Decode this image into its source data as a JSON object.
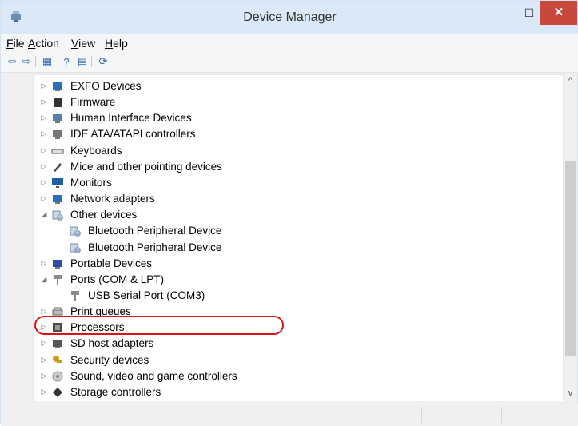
{
  "window": {
    "title": "Device Manager"
  },
  "menu": [
    {
      "label": "File",
      "underline": "F",
      "rest": "ile"
    },
    {
      "label": "Action",
      "underline": "A",
      "rest": "ction"
    },
    {
      "label": "View",
      "underline": "V",
      "rest": "iew"
    },
    {
      "label": "Help",
      "underline": "H",
      "rest": "elp"
    }
  ],
  "toolbar": [
    {
      "name": "back-icon",
      "glyph": "⇦"
    },
    {
      "name": "forward-icon",
      "glyph": "⇨"
    },
    {
      "name": "properties-icon",
      "glyph": "▦"
    },
    {
      "name": "help-icon",
      "glyph": "?"
    },
    {
      "name": "view-icon",
      "glyph": "▤"
    },
    {
      "name": "scan-hardware-icon",
      "glyph": "⟳"
    }
  ],
  "tree": [
    {
      "label": "EXFO Devices",
      "level": 0,
      "state": "collapsed",
      "icon": "network-device-icon",
      "color": "#2c6fb5"
    },
    {
      "label": "Firmware",
      "level": 0,
      "state": "collapsed",
      "icon": "firmware-chip-icon",
      "color": "#333333"
    },
    {
      "label": "Human Interface Devices",
      "level": 0,
      "state": "collapsed",
      "icon": "hid-icon",
      "color": "#5b7ea8"
    },
    {
      "label": "IDE ATA/ATAPI controllers",
      "level": 0,
      "state": "collapsed",
      "icon": "ide-controller-icon",
      "color": "#777777"
    },
    {
      "label": "Keyboards",
      "level": 0,
      "state": "collapsed",
      "icon": "keyboard-icon",
      "color": "#555555"
    },
    {
      "label": "Mice and other pointing devices",
      "level": 0,
      "state": "collapsed",
      "icon": "mouse-icon",
      "color": "#444444"
    },
    {
      "label": "Monitors",
      "level": 0,
      "state": "collapsed",
      "icon": "monitor-icon",
      "color": "#1f5fa8"
    },
    {
      "label": "Network adapters",
      "level": 0,
      "state": "collapsed",
      "icon": "network-adapter-icon",
      "color": "#2c6fb5"
    },
    {
      "label": "Other devices",
      "level": 0,
      "state": "expanded",
      "icon": "unknown-device-icon",
      "color": "#7a8fa8"
    },
    {
      "label": "Bluetooth Peripheral Device",
      "level": 1,
      "state": "leaf",
      "icon": "unknown-device-icon",
      "color": "#7a8fa8"
    },
    {
      "label": "Bluetooth Peripheral Device",
      "level": 1,
      "state": "leaf",
      "icon": "unknown-device-icon",
      "color": "#7a8fa8"
    },
    {
      "label": "Portable Devices",
      "level": 0,
      "state": "collapsed",
      "icon": "portable-device-icon",
      "color": "#2c4fa0"
    },
    {
      "label": "Ports (COM & LPT)",
      "level": 0,
      "state": "expanded",
      "icon": "port-icon",
      "color": "#8a8a8a"
    },
    {
      "label": "USB Serial Port (COM3)",
      "level": 1,
      "state": "leaf",
      "icon": "port-icon",
      "color": "#8a8a8a"
    },
    {
      "label": "Print queues",
      "level": 0,
      "state": "collapsed",
      "icon": "printer-icon",
      "color": "#666666"
    },
    {
      "label": "Processors",
      "level": 0,
      "state": "collapsed",
      "icon": "processor-icon",
      "color": "#4a4a4a"
    },
    {
      "label": "SD host adapters",
      "level": 0,
      "state": "collapsed",
      "icon": "sd-adapter-icon",
      "color": "#555555"
    },
    {
      "label": "Security devices",
      "level": 0,
      "state": "collapsed",
      "icon": "security-key-icon",
      "color": "#c99a1e"
    },
    {
      "label": "Sound, video and game controllers",
      "level": 0,
      "state": "collapsed",
      "icon": "sound-icon",
      "color": "#888888"
    },
    {
      "label": "Storage controllers",
      "level": 0,
      "state": "collapsed",
      "icon": "storage-icon",
      "color": "#333333"
    }
  ],
  "colors": {
    "titlebar": "#dbe8f7",
    "close": "#c9483d",
    "highlight": "#d8141a"
  }
}
